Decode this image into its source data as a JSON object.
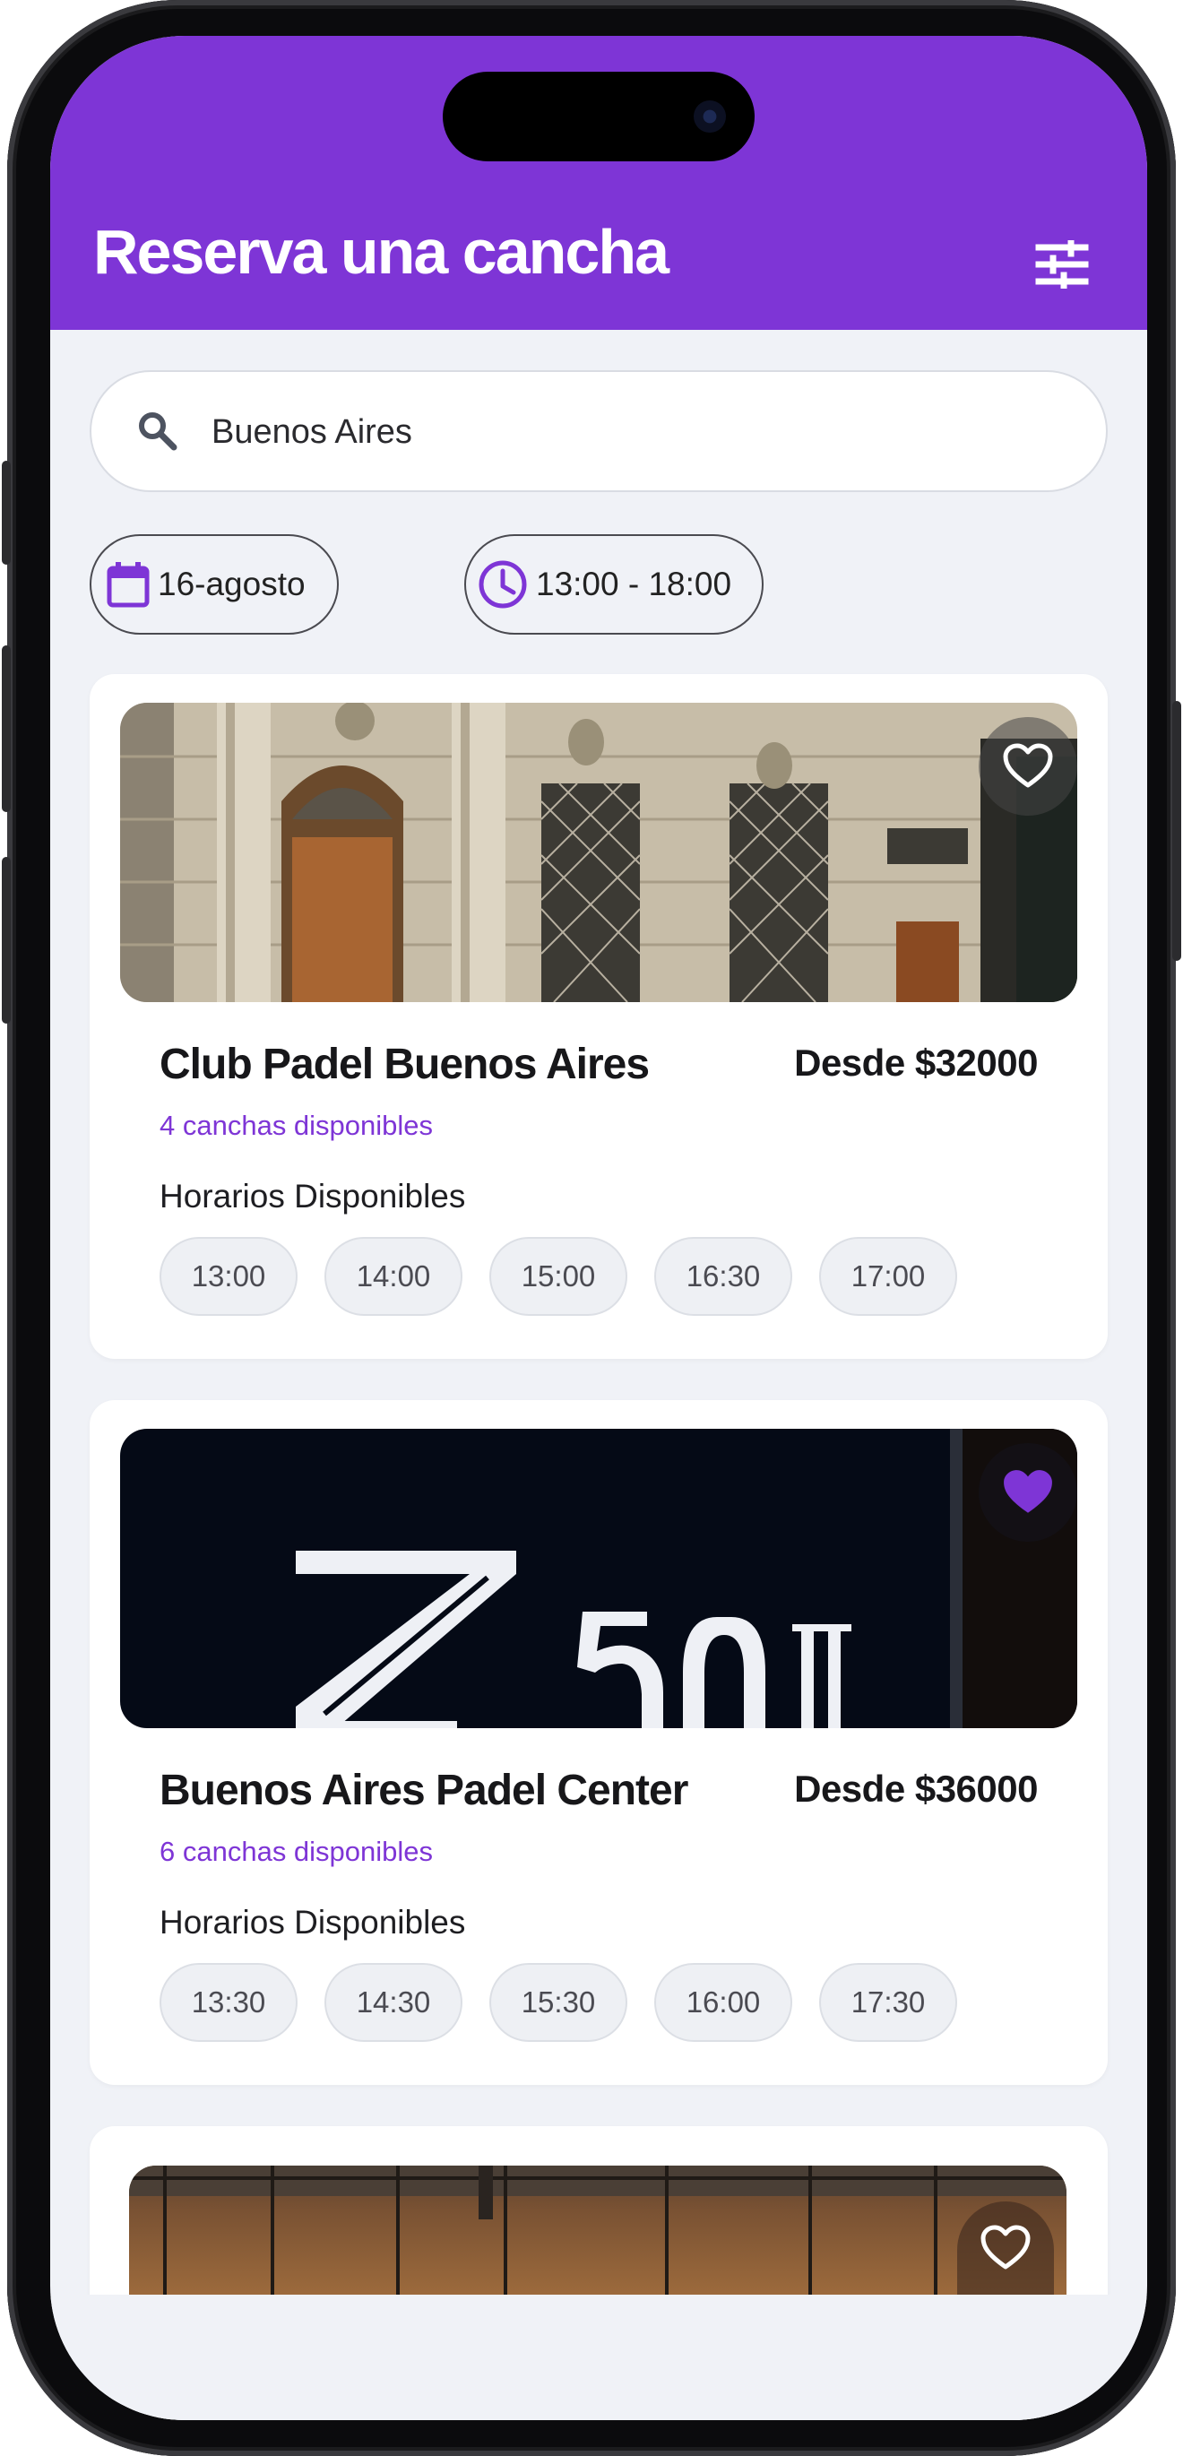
{
  "header": {
    "title": "Reserva una cancha",
    "filter_icon": "sliders-icon"
  },
  "search": {
    "value": "Buenos Aires",
    "icon": "search-icon"
  },
  "filters": {
    "date": {
      "label": "16-agosto",
      "icon": "calendar-icon"
    },
    "time": {
      "label": "13:00 - 18:00",
      "icon": "clock-icon"
    }
  },
  "clubs": [
    {
      "name": "Club Padel Buenos Aires",
      "price": "Desde $32000",
      "courts": "4 canchas disponibles",
      "hours_heading": "Horarios Disponibles",
      "favorite": false,
      "slots": [
        "13:00",
        "14:00",
        "15:00",
        "16:30",
        "17:00"
      ]
    },
    {
      "name": "Buenos Aires Padel Center",
      "price": "Desde $36000",
      "courts": "6 canchas disponibles",
      "hours_heading": "Horarios Disponibles",
      "favorite": true,
      "slots": [
        "13:30",
        "14:30",
        "15:30",
        "16:00",
        "17:30"
      ]
    },
    {
      "favorite": false
    }
  ],
  "colors": {
    "accent": "#7e35d6",
    "background": "#f0f2f7",
    "card": "#ffffff",
    "text": "#17171a"
  }
}
